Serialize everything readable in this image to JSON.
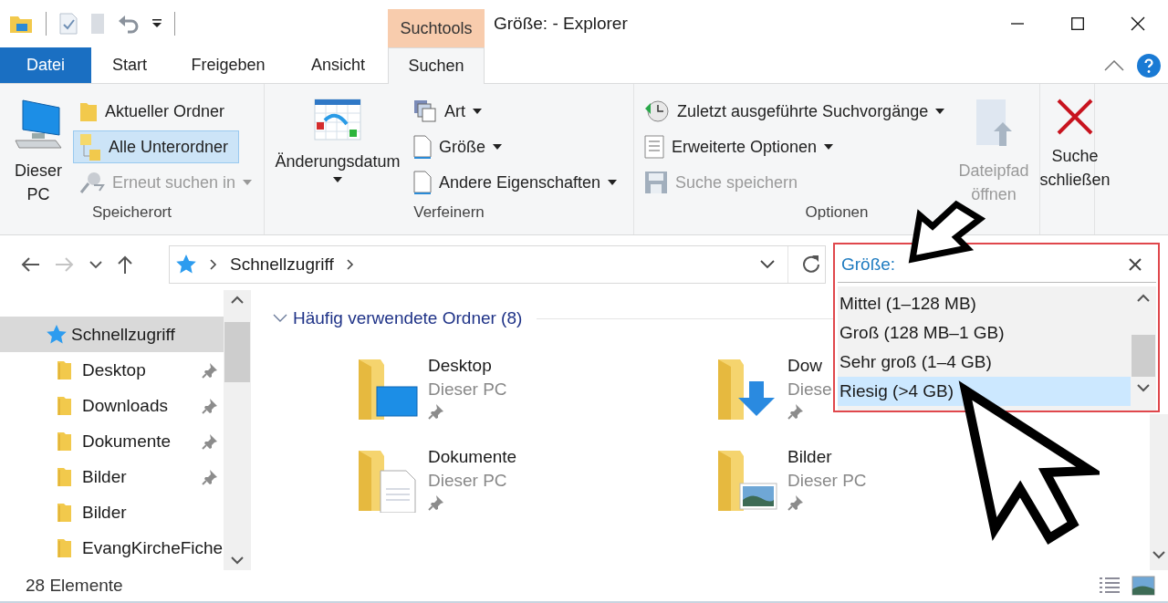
{
  "contextual_tab": {
    "label": "Suchtools"
  },
  "window": {
    "title": "Größe: - Explorer"
  },
  "tabs": [
    {
      "label": "Datei",
      "kind": "file",
      "selected": false
    },
    {
      "label": "Start",
      "kind": "tab",
      "selected": false
    },
    {
      "label": "Freigeben",
      "kind": "tab",
      "selected": false
    },
    {
      "label": "Ansicht",
      "kind": "tab",
      "selected": false
    },
    {
      "label": "Suchen",
      "kind": "tab",
      "selected": true
    }
  ],
  "ribbon": {
    "groups": [
      {
        "label": "Speicherort",
        "items": [
          {
            "label": "Dieser PC",
            "kind": "large"
          },
          {
            "label": "Aktueller Ordner",
            "kind": "small",
            "selected": false
          },
          {
            "label": "Alle Unterordner",
            "kind": "small",
            "selected": true
          },
          {
            "label": "Erneut suchen in",
            "kind": "small",
            "selected": false,
            "disabled": true,
            "dropdown": true
          }
        ]
      },
      {
        "label": "Verfeinern",
        "items": [
          {
            "label": "Änderungsdatum",
            "kind": "large",
            "dropdown": true
          },
          {
            "label": "Art",
            "kind": "small",
            "dropdown": true
          },
          {
            "label": "Größe",
            "kind": "small",
            "dropdown": true
          },
          {
            "label": "Andere Eigenschaften",
            "kind": "small",
            "dropdown": true
          }
        ]
      },
      {
        "label": "Optionen",
        "items": [
          {
            "label": "Zuletzt ausgeführte Suchvorgänge",
            "kind": "small",
            "dropdown": true
          },
          {
            "label": "Erweiterte Optionen",
            "kind": "small",
            "dropdown": true
          },
          {
            "label": "Suche speichern",
            "kind": "small",
            "disabled": true
          },
          {
            "label": "Dateipfad öffnen",
            "kind": "large",
            "disabled": true
          }
        ]
      },
      {
        "items": [
          {
            "label": "Suche schließen",
            "kind": "large"
          }
        ]
      }
    ]
  },
  "nav_buttons": [
    {
      "kind": "back",
      "disabled": false
    },
    {
      "kind": "forward",
      "disabled": true
    },
    {
      "kind": "recent",
      "disabled": false
    },
    {
      "kind": "up",
      "disabled": false
    }
  ],
  "address": {
    "breadcrumbs": [
      "Schnellzugriff"
    ]
  },
  "search": {
    "value": "Größe:"
  },
  "suggestions": [
    {
      "label": "Mittel (1–128 MB)",
      "selected": false
    },
    {
      "label": "Groß (128 MB–1 GB)",
      "selected": false
    },
    {
      "label": "Sehr groß (1–4 GB)",
      "selected": false
    },
    {
      "label": "Riesig (>4 GB)",
      "selected": true
    }
  ],
  "nav_pane": [
    {
      "label": "Schnellzugriff",
      "selected": true,
      "children": [
        {
          "label": "Desktop",
          "selected": false,
          "pinned": true
        },
        {
          "label": "Downloads",
          "selected": false,
          "pinned": true
        },
        {
          "label": "Dokumente",
          "selected": false,
          "pinned": true
        },
        {
          "label": "Bilder",
          "selected": false,
          "pinned": true
        },
        {
          "label": "Bilder",
          "selected": false,
          "pinned": false
        },
        {
          "label": "EvangKircheFiche",
          "selected": false,
          "pinned": false
        }
      ]
    }
  ],
  "content": {
    "group": {
      "label": "Häufig verwendete Ordner (8)",
      "expanded": true
    },
    "tiles": [
      {
        "name": "Desktop",
        "location": "Dieser PC",
        "pinned": true
      },
      {
        "name": "Dow",
        "location": "Diese",
        "pinned": true
      },
      {
        "name": "Dokumente",
        "location": "Dieser PC",
        "pinned": true
      },
      {
        "name": "Bilder",
        "location": "Dieser PC",
        "pinned": true
      }
    ]
  },
  "status_bar": {
    "count": "28 Elemente"
  }
}
